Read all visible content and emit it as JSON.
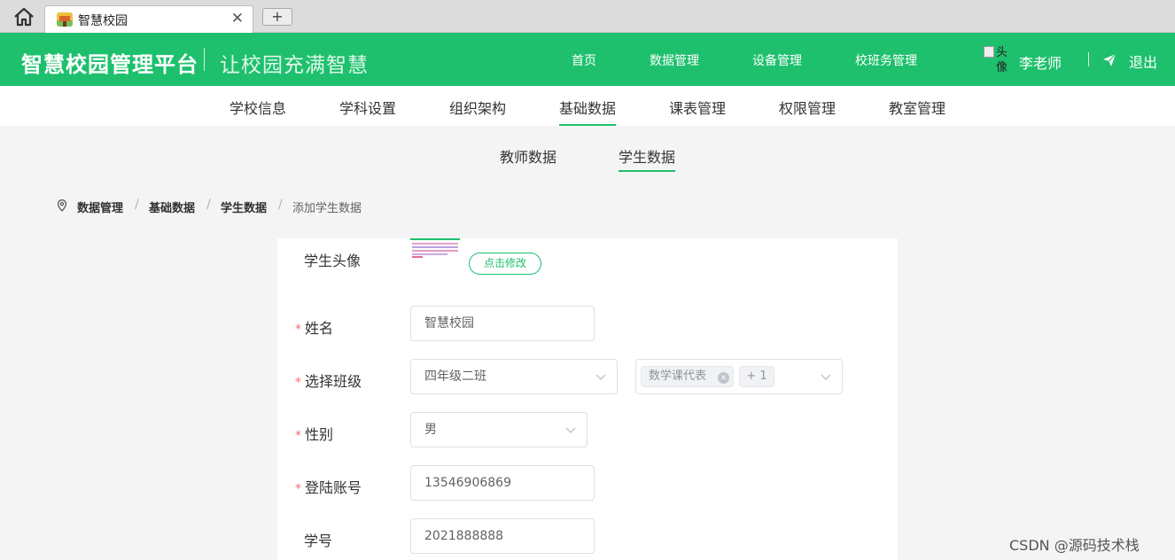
{
  "browser": {
    "tab_title": "智慧校园",
    "new_tab_label": "+",
    "close_label": "✕"
  },
  "header": {
    "brand": "智慧校园管理平台",
    "slogan": "让校园充满智慧",
    "nav": [
      "首页",
      "数据管理",
      "设备管理",
      "校班务管理"
    ],
    "avatar_alt": "头像",
    "user_name": "李老师",
    "logout": "退出",
    "accent_color": "#1ec06d"
  },
  "subnav": {
    "items": [
      "学校信息",
      "学科设置",
      "组织架构",
      "基础数据",
      "课表管理",
      "权限管理",
      "教室管理"
    ],
    "active": "基础数据"
  },
  "inner_tabs": {
    "items": [
      "教师数据",
      "学生数据"
    ],
    "active": "学生数据"
  },
  "breadcrumb": [
    "数据管理",
    "基础数据",
    "学生数据",
    "添加学生数据"
  ],
  "form": {
    "avatar_label": "学生头像",
    "edit_button": "点击修改",
    "required_mark": "*",
    "name_label": "姓名",
    "name_value": "智慧校园",
    "class_label": "选择班级",
    "class_value": "四年级二班",
    "role_tag": "数学课代表",
    "role_more": "+ 1",
    "gender_label": "性别",
    "gender_value": "男",
    "account_label": "登陆账号",
    "account_value": "13546906869",
    "student_no_label": "学号",
    "student_no_value": "2021888888"
  },
  "watermark": "CSDN @源码技术栈"
}
